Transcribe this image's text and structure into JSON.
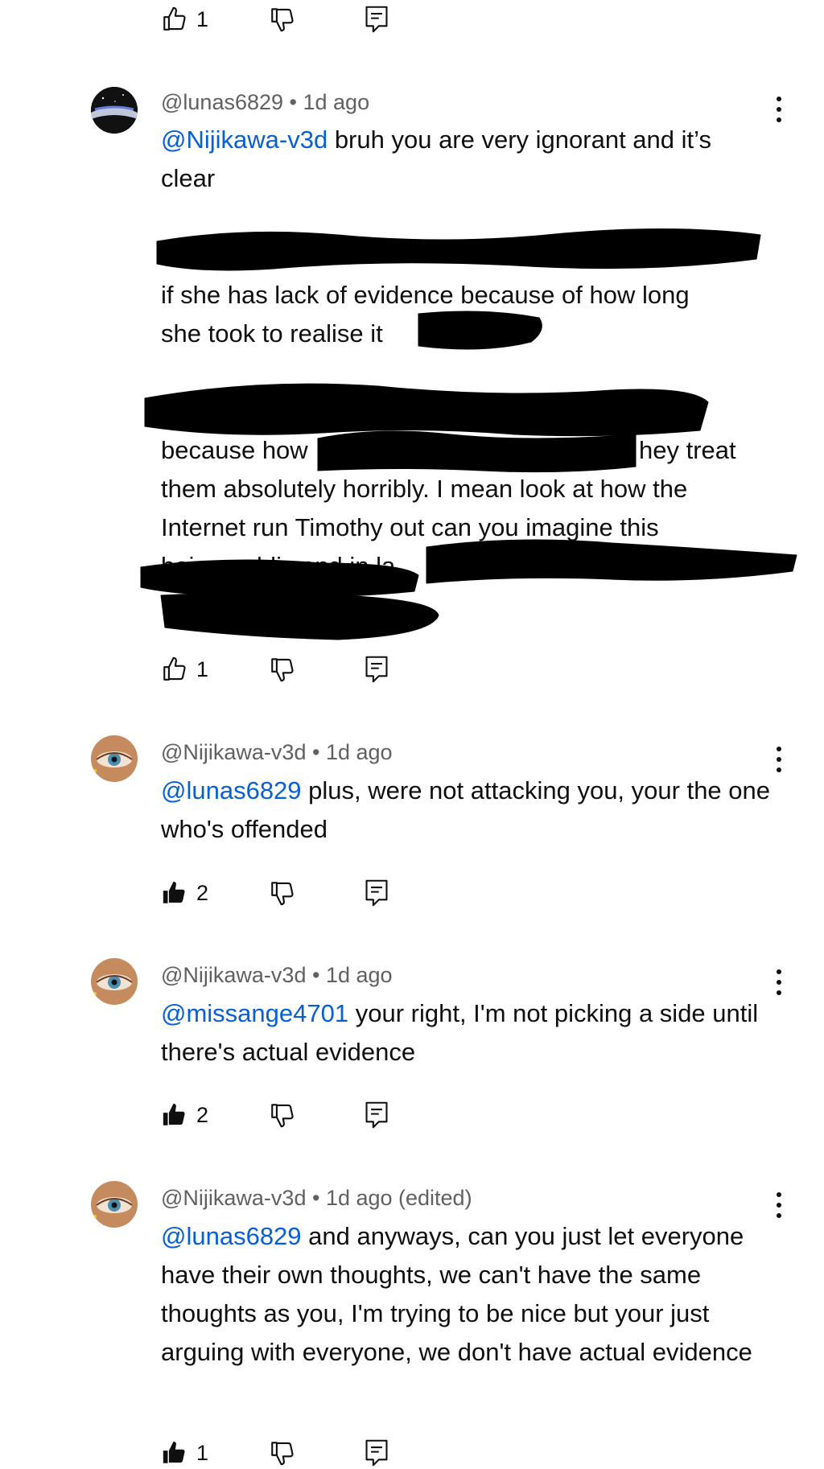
{
  "top_actions": {
    "like_count": "1"
  },
  "comments": [
    {
      "author": "@lunas6829",
      "time": "1d ago",
      "mention": "@Nijikawa-v3d",
      "text": " bruh you are very ignorant and it’s clear",
      "lines_visible": [
        "if she has lack of evidence because of how long",
        "she took to realise it",
        "because how",
        "hey treat",
        "them absolutely horribly. I mean look at how the",
        "Internet run Timothy out can you imagine this",
        "being public and in la"
      ],
      "like_count": "1",
      "liked": false
    },
    {
      "author": "@Nijikawa-v3d",
      "time": "1d ago",
      "mention": "@lunas6829",
      "text": "  plus, were not attacking you, your the one who's offended",
      "like_count": "2",
      "liked": true
    },
    {
      "author": "@Nijikawa-v3d",
      "time": "1d ago",
      "mention": "@missange4701",
      "text": " your right, I'm not picking a side until there's actual evidence",
      "like_count": "2",
      "liked": true
    },
    {
      "author": "@Nijikawa-v3d",
      "time": "1d ago (edited)",
      "mention": "@lunas6829",
      "text": "  and anyways, can you just let everyone have their own thoughts, we can't have the same thoughts as you, I'm trying to be nice but your just arguing with everyone, we don't have actual evidence",
      "like_count": "1",
      "liked": true
    }
  ],
  "separator": " • ",
  "icons": {
    "like": "thumbs-up-icon",
    "dislike": "thumbs-down-icon",
    "reply": "reply-icon",
    "menu": "more-vert-icon"
  },
  "colors": {
    "mention": "#065fd4",
    "meta": "#606060",
    "text": "#0f0f0f"
  }
}
